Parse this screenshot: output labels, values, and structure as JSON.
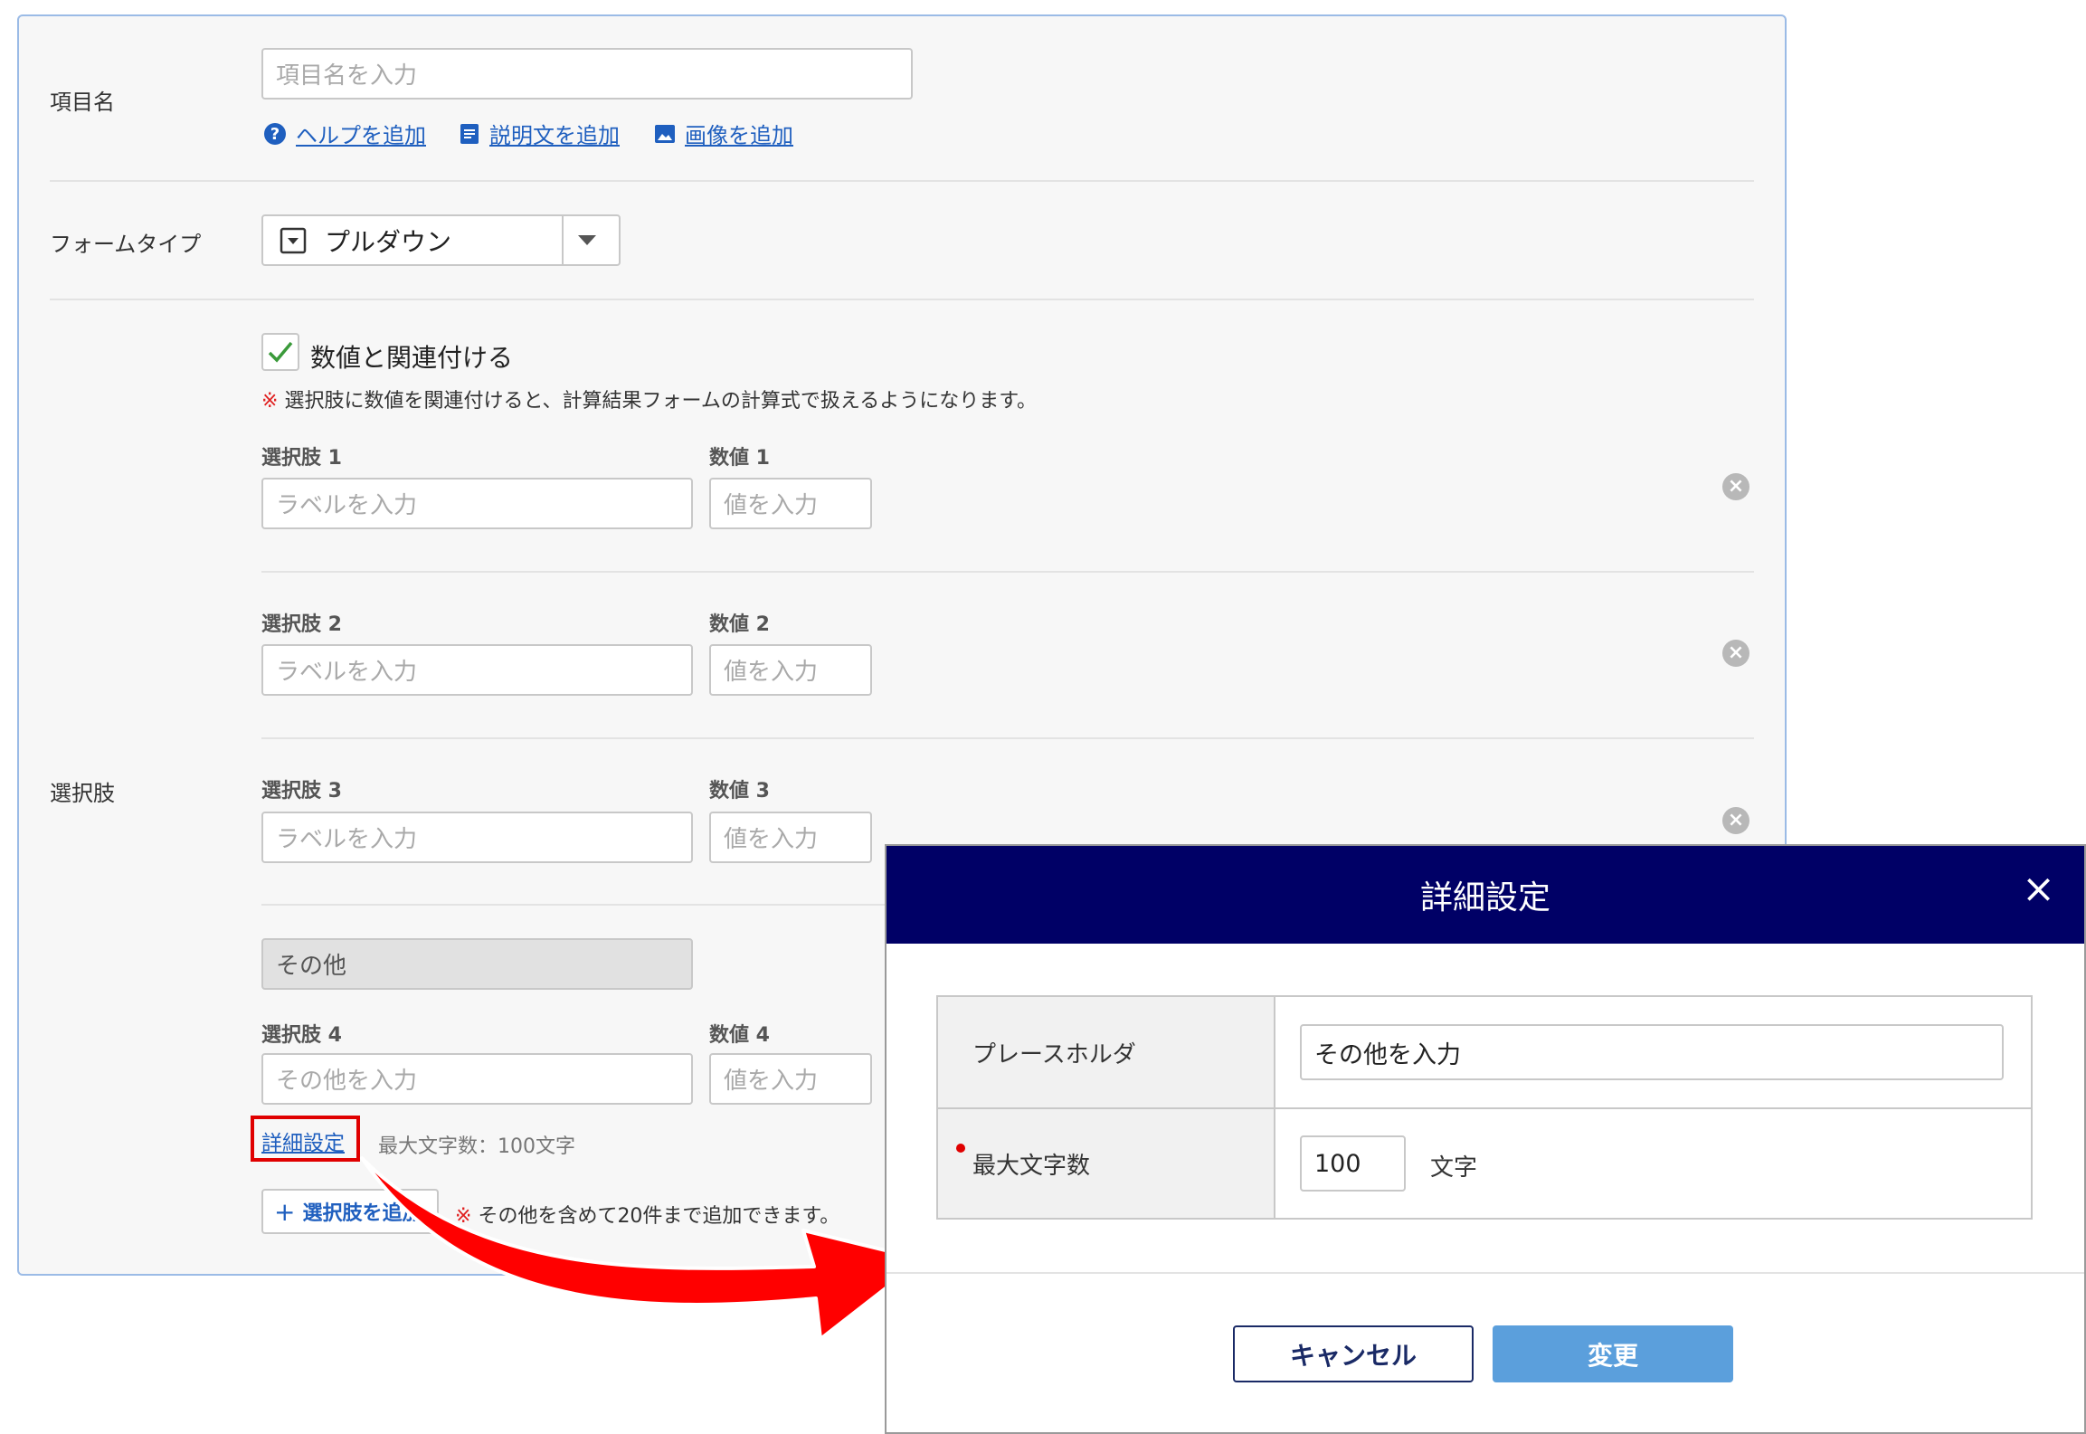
{
  "form": {
    "item_name": {
      "label": "項目名",
      "placeholder": "項目名を入力",
      "help_link": "ヘルプを追加",
      "description_link": "説明文を追加",
      "image_link": "画像を追加"
    },
    "form_type": {
      "label": "フォームタイプ",
      "selected": "プルダウン"
    },
    "choices": {
      "label": "選択肢",
      "link_numbers_checkbox": {
        "label": "数値と関連付ける",
        "checked": true
      },
      "note_mark": "※",
      "note": "選択肢に数値を関連付けると、計算結果フォームの計算式で扱えるようになります。",
      "items": [
        {
          "label_caption": "選択肢 1",
          "value_caption": "数値 1",
          "label_placeholder": "ラベルを入力",
          "value_placeholder": "値を入力"
        },
        {
          "label_caption": "選択肢 2",
          "value_caption": "数値 2",
          "label_placeholder": "ラベルを入力",
          "value_placeholder": "値を入力"
        },
        {
          "label_caption": "選択肢 3",
          "value_caption": "数値 3",
          "label_placeholder": "ラベルを入力",
          "value_placeholder": "値を入力"
        }
      ],
      "other": {
        "label": "その他",
        "label_caption": "選択肢 4",
        "value_caption": "数値 4",
        "label_placeholder": "その他を入力",
        "value_placeholder": "値を入力",
        "details_link": "詳細設定",
        "max_chars_text": "最大文字数：100文字"
      },
      "add_button": "選択肢を追加",
      "add_note_mark": "※",
      "add_note": "その他を含めて20件まで追加できます。"
    }
  },
  "modal": {
    "title": "詳細設定",
    "placeholder_row": {
      "label": "プレースホルダ",
      "value": "その他を入力"
    },
    "max_chars_row": {
      "label": "最大文字数",
      "value": "100",
      "unit": "文字"
    },
    "cancel_button": "キャンセル",
    "change_button": "変更"
  },
  "colors": {
    "modal_header": "#000066",
    "link": "#1f5fbf",
    "primary_button": "#5b9fdc",
    "highlight": "#e00000",
    "note_mark": "#e02020"
  },
  "icons": [
    "help-icon",
    "description-icon",
    "image-icon",
    "dropdown-icon",
    "caret-down-icon",
    "check-icon",
    "remove-icon",
    "plus-icon",
    "close-icon",
    "arrow-annotation"
  ]
}
